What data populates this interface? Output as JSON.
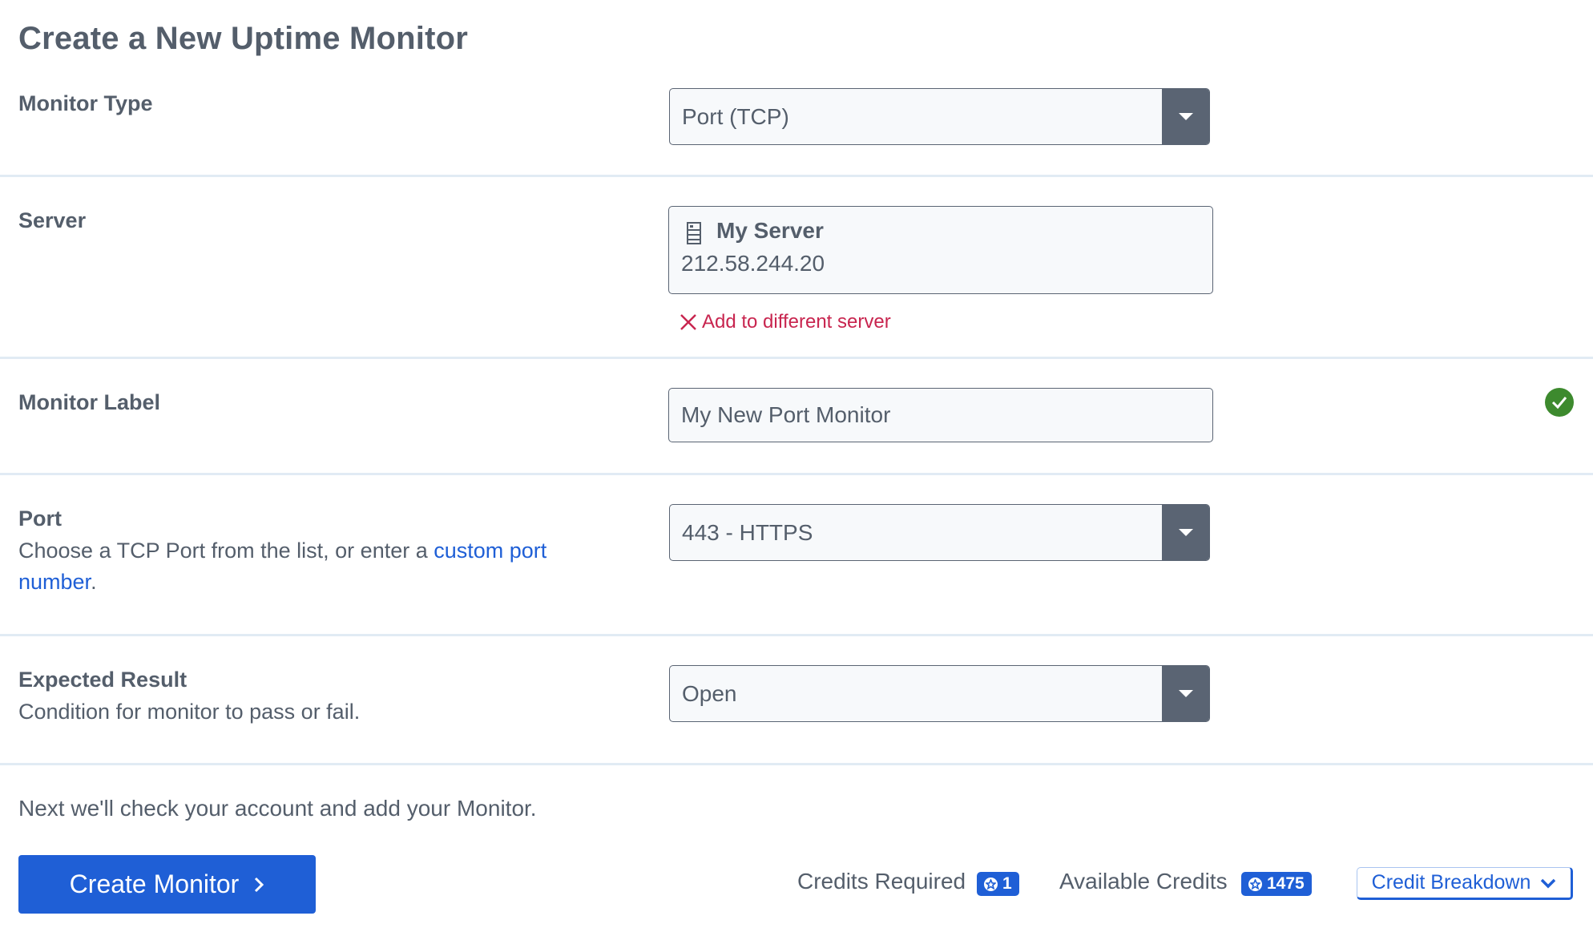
{
  "page": {
    "title": "Create a New Uptime Monitor"
  },
  "monitor_type": {
    "label": "Monitor Type",
    "selected": "Port (TCP)"
  },
  "server": {
    "label": "Server",
    "name": "My Server",
    "ip": "212.58.244.20",
    "change_link": "Add to different server"
  },
  "monitor_label": {
    "label": "Monitor Label",
    "value": "My New Port Monitor",
    "valid": true
  },
  "port": {
    "label": "Port",
    "description_prefix": "Choose a TCP Port from the list, or enter a ",
    "description_link": "custom port number",
    "description_suffix": ".",
    "selected": "443 - HTTPS"
  },
  "expected_result": {
    "label": "Expected Result",
    "description": "Condition for monitor to pass or fail.",
    "selected": "Open"
  },
  "footer": {
    "next_text": "Next we'll check your account and add your Monitor.",
    "create_button": "Create Monitor",
    "credits_required_label": "Credits Required",
    "credits_required_value": "1",
    "available_credits_label": "Available Credits",
    "available_credits_value": "1475",
    "breakdown_button": "Credit Breakdown"
  },
  "colors": {
    "text": "#545e6b",
    "accent": "#1f5fd6",
    "danger": "#c8254f",
    "success": "#3d8a2e",
    "divider": "#e1ebf4",
    "select_button": "#5a6473"
  }
}
